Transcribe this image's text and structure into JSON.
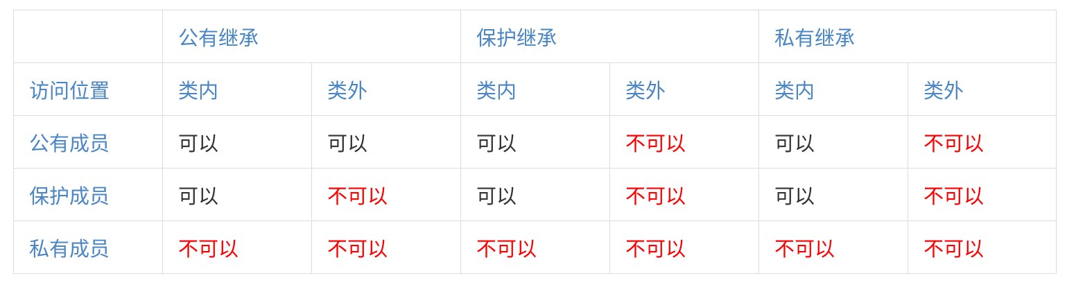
{
  "table": {
    "inheritance_headers": [
      "公有继承",
      "保护继承",
      "私有继承"
    ],
    "access_position_label": "访问位置",
    "sub_headers": [
      "类内",
      "类外",
      "类内",
      "类外",
      "类内",
      "类外"
    ],
    "rows": [
      {
        "member": "公有成员",
        "cells": [
          {
            "text": "可以",
            "allowed": true
          },
          {
            "text": "可以",
            "allowed": true
          },
          {
            "text": "可以",
            "allowed": true
          },
          {
            "text": "不可以",
            "allowed": false
          },
          {
            "text": "可以",
            "allowed": true
          },
          {
            "text": "不可以",
            "allowed": false
          }
        ]
      },
      {
        "member": "保护成员",
        "cells": [
          {
            "text": "可以",
            "allowed": true
          },
          {
            "text": "不可以",
            "allowed": false
          },
          {
            "text": "可以",
            "allowed": true
          },
          {
            "text": "不可以",
            "allowed": false
          },
          {
            "text": "可以",
            "allowed": true
          },
          {
            "text": "不可以",
            "allowed": false
          }
        ]
      },
      {
        "member": "私有成员",
        "cells": [
          {
            "text": "不可以",
            "allowed": false
          },
          {
            "text": "不可以",
            "allowed": false
          },
          {
            "text": "不可以",
            "allowed": false
          },
          {
            "text": "不可以",
            "allowed": false
          },
          {
            "text": "不可以",
            "allowed": false
          },
          {
            "text": "不可以",
            "allowed": false
          }
        ]
      }
    ]
  },
  "colors": {
    "header_text": "#4a86c5",
    "allowed_text": "#333333",
    "denied_text": "#ff0000",
    "border": "#dcdcdc"
  }
}
